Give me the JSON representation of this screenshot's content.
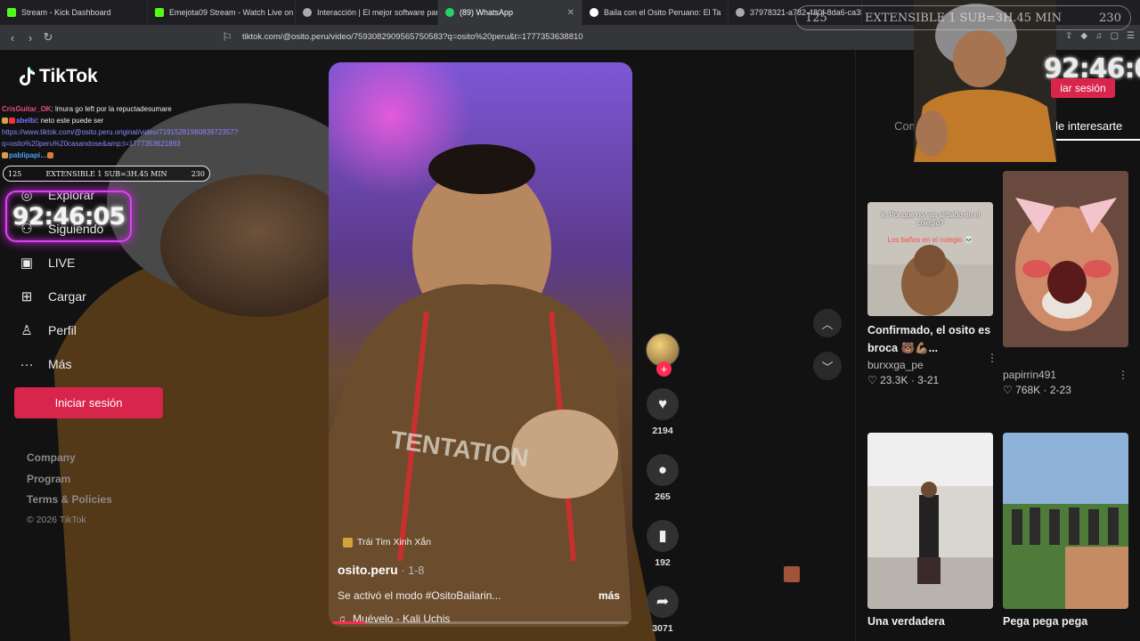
{
  "browser": {
    "tabs": [
      {
        "label": "Stream - Kick Dashboard",
        "favicon_color": "#53fc18",
        "active": false
      },
      {
        "label": "Emejota09 Stream - Watch Live on K",
        "favicon_color": "#53fc18",
        "active": false
      },
      {
        "label": "Interacción | El mejor software para p",
        "favicon_color": "#aaaaaa",
        "active": false
      },
      {
        "label": "(89) WhatsApp",
        "favicon_color": "#25d366",
        "active": true
      },
      {
        "label": "Baila con el Osito Peruano: El Ta",
        "favicon_color": "#ffffff",
        "active": false
      },
      {
        "label": "37978321-a782-480f-8da6-ca3b09d",
        "favicon_color": "#aaaaaa",
        "active": false
      }
    ],
    "url": "tiktok.com/@osito.peru/video/7593082909565750583?q=osito%20peru&t=1777353638810"
  },
  "sidebar": {
    "logo": "TikTok",
    "nav": [
      {
        "label": "Explorar",
        "icon": "compass-icon"
      },
      {
        "label": "Siguiendo",
        "icon": "following-icon"
      },
      {
        "label": "LIVE",
        "icon": "live-icon"
      },
      {
        "label": "Cargar",
        "icon": "upload-icon"
      },
      {
        "label": "Perfil",
        "icon": "profile-icon"
      },
      {
        "label": "Más",
        "icon": "more-icon"
      }
    ],
    "login_label": "Iniciar sesión",
    "footer": [
      "Company",
      "Program",
      "Terms & Policies"
    ],
    "copyright": "© 2026 TikTok"
  },
  "chat": {
    "lines": [
      {
        "user": "CrisGuitar_OK",
        "text": ": lmura go left por la repuctadesumare"
      },
      {
        "user": "abelbi",
        "text": ": neto este puede ser"
      },
      {
        "link": "https://www.tiktok.com/@osito.peru.original/video/7191528198083972357?q=osito%20peru%20casandose&amp;t=1777353621893"
      },
      {
        "user": "pablipapi…",
        "text": ""
      }
    ]
  },
  "stream_overlay": {
    "sub_left": "125",
    "sub_text": "EXTENSIBLE 1 SUB=3H.45 MIN",
    "sub_right": "230",
    "timer": "92:46:05",
    "cam_login_text": "iar sesión"
  },
  "video": {
    "song_badge": "Trái Tim Xinh Xắn",
    "author": "osito.peru",
    "date": "· 1-8",
    "description": "Se activó el modo #OsitoBailarin...",
    "more_label": "más",
    "music": "Muévelo - Kali Uchis",
    "progress": 0.11,
    "likes": "2194",
    "comments": "265",
    "saves": "192",
    "shares": "3071"
  },
  "right_panel": {
    "tabs": [
      "Comentarios",
      "Te puede interesarte"
    ],
    "cards": [
      {
        "title": "Confirmado, el osito es broca 🐻💪🏽...",
        "user": "burxxga_pe",
        "likes": "23.3K",
        "date": "3-21",
        "thumb_text1": "X: Por que no vas al baño en el colegio?",
        "thumb_text2": "Los baños en el colegio 💀"
      },
      {
        "title": "",
        "user": "papirrin491",
        "likes": "768K",
        "date": "2-23"
      },
      {
        "title": "Una verdadera",
        "user": "",
        "likes": "",
        "date": ""
      },
      {
        "title": "Pega pega pega",
        "user": "",
        "likes": "",
        "date": ""
      }
    ]
  }
}
